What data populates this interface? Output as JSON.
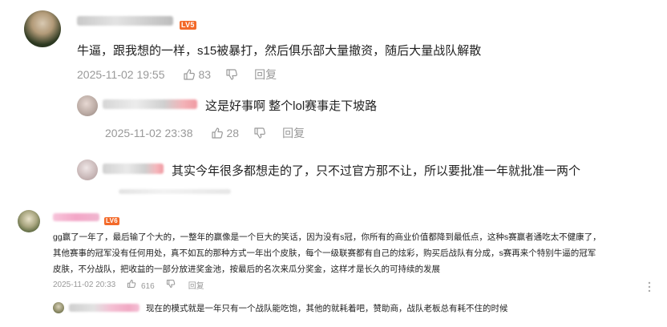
{
  "comments": [
    {
      "level": "LV5",
      "text": "牛逼，跟我想的一样，s15被暴打，然后俱乐部大量撤资，随后大量战队解散",
      "time": "2025-11-02 19:55",
      "likes": "83",
      "reply_label": "回复",
      "replies": [
        {
          "text": "这是好事啊 整个lol赛事走下坡路",
          "time": "2025-11-02 23:38",
          "likes": "28",
          "reply_label": "回复"
        },
        {
          "text": "其实今年很多都想走的了，只不过官方那不让，所以要批准一年就批准一两个"
        }
      ]
    },
    {
      "level": "LV6",
      "text_lines": [
        "gg赢了一年了，最后输了个大的，一整年的赢像是一个巨大的笑话，因为没有s冠，你所有的商业价值都降到最低点，这种s赛赢者通吃太不健康了，",
        "其他赛事的冠军没有任何用处，真不如瓦的那种方式一年出个皮肤，每个一级联赛都有自己的炫彩，购买后战队有分成，s赛再来个特别牛逼的冠军",
        "皮肤，不分战队，把收益的一部分放进奖金池，按最后的名次来瓜分奖金，这样才是长久的可持续的发展"
      ],
      "time": "2025-11-02 20:33",
      "likes": "616",
      "reply_label": "回复",
      "more_icon": "more-dots-icon",
      "replies": [
        {
          "text": "现在的模式就是一年只有一个战队能吃饱，其他的就耗着吧，赞助商，战队老板总有耗不住的时候"
        }
      ]
    }
  ],
  "colors": {
    "level5": "#f36a2a",
    "level6": "#f36a2a",
    "meta": "#999999",
    "text": "#222222"
  }
}
